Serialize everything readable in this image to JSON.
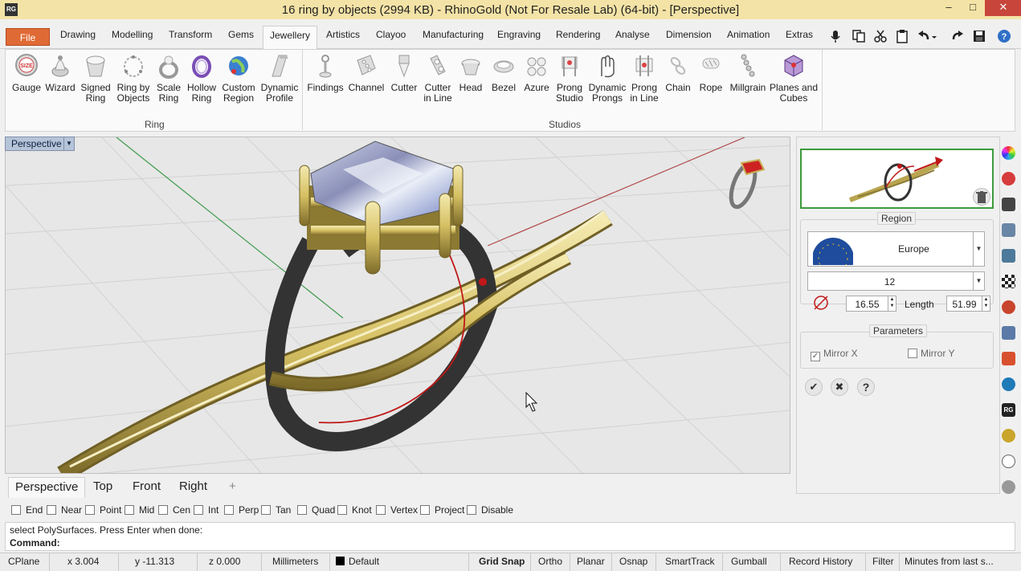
{
  "window": {
    "title": "16 ring by objects (2994 KB) - RhinoGold (Not For Resale Lab) (64-bit) - [Perspective]",
    "logo": "RG",
    "minimize": "–",
    "maximize": "□",
    "close": "✕"
  },
  "menu": {
    "file": "File",
    "tabs": [
      "Drawing",
      "Modelling",
      "Transform",
      "Gems",
      "Jewellery",
      "Artistics",
      "Clayoo",
      "Manufacturing",
      "Engraving",
      "Rendering",
      "Analyse",
      "Dimension",
      "Animation",
      "Extras"
    ],
    "active": "Jewellery",
    "quick_icons": [
      "microphone-icon",
      "copy-icon",
      "cut-icon",
      "paste-icon",
      "undo-icon",
      "redo-icon",
      "save-icon",
      "help-icon"
    ]
  },
  "ribbon": {
    "ring_group": "Ring",
    "studios_group": "Studios",
    "ring_buttons": [
      [
        "Gauge",
        ""
      ],
      [
        "Wizard",
        ""
      ],
      [
        "Signed",
        "Ring"
      ],
      [
        "Ring by",
        "Objects"
      ],
      [
        "Scale",
        "Ring"
      ],
      [
        "Hollow",
        "Ring"
      ],
      [
        "Custom",
        "Region"
      ],
      [
        "Dynamic",
        "Profile"
      ]
    ],
    "studio_buttons": [
      [
        "Findings",
        ""
      ],
      [
        "Channel",
        ""
      ],
      [
        "Cutter",
        ""
      ],
      [
        "Cutter",
        "in Line"
      ],
      [
        "Head",
        ""
      ],
      [
        "Bezel",
        ""
      ],
      [
        "Azure",
        ""
      ],
      [
        "Prong",
        "Studio"
      ],
      [
        "Dynamic",
        "Prongs"
      ],
      [
        "Prong",
        "in Line"
      ],
      [
        "Chain",
        ""
      ],
      [
        "Rope",
        ""
      ],
      [
        "Millgrain",
        ""
      ],
      [
        "Planes and",
        "Cubes"
      ]
    ],
    "gauge_icon_text": "SIZE"
  },
  "viewport": {
    "label": "Perspective",
    "tabs": [
      "Perspective",
      "Top",
      "Front",
      "Right"
    ],
    "add_tab": "+"
  },
  "osnap": {
    "items": [
      "End",
      "Near",
      "Point",
      "Mid",
      "Cen",
      "Int",
      "Perp",
      "Tan",
      "Quad",
      "Knot",
      "Vertex",
      "Project",
      "Disable"
    ]
  },
  "command": {
    "history": "select PolySurfaces. Press Enter when done:",
    "prompt": "Command:"
  },
  "status": {
    "cplane": "CPlane",
    "x": "x 3.004",
    "y": "y -11.313",
    "z": "z 0.000",
    "units": "Millimeters",
    "layer": "Default",
    "toggles": [
      "Grid Snap",
      "Ortho",
      "Planar",
      "Osnap",
      "SmartTrack",
      "Gumball",
      "Record History",
      "Filter",
      "Minutes from last s..."
    ]
  },
  "panel": {
    "region_legend": "Region",
    "region_value": "Europe",
    "size_value": "12",
    "diameter_value": "16.55",
    "length_label": "Length",
    "length_value": "51.99",
    "parameters_legend": "Parameters",
    "mirror_x": "Mirror X",
    "mirror_y": "Mirror Y",
    "mirror_x_checked": "✓",
    "ok": "✔",
    "cancel": "✖",
    "help": "?"
  },
  "sidebar_icons": [
    "color-wheel-icon",
    "render-icon",
    "display-icon",
    "layer-icon",
    "properties-icon",
    "checker-icon",
    "bug-icon",
    "edit-icon",
    "paint-icon",
    "globe-icon",
    "rg-icon",
    "ring-icon",
    "clock-icon",
    "settings-icon"
  ],
  "colors": {
    "title_bg": "#f4e3a6",
    "file_tab": "#e06a35",
    "close_btn": "#c7453b",
    "preview_border": "#3d9a3d",
    "gold": "#d8c676",
    "shank": "#3a3a3a"
  }
}
